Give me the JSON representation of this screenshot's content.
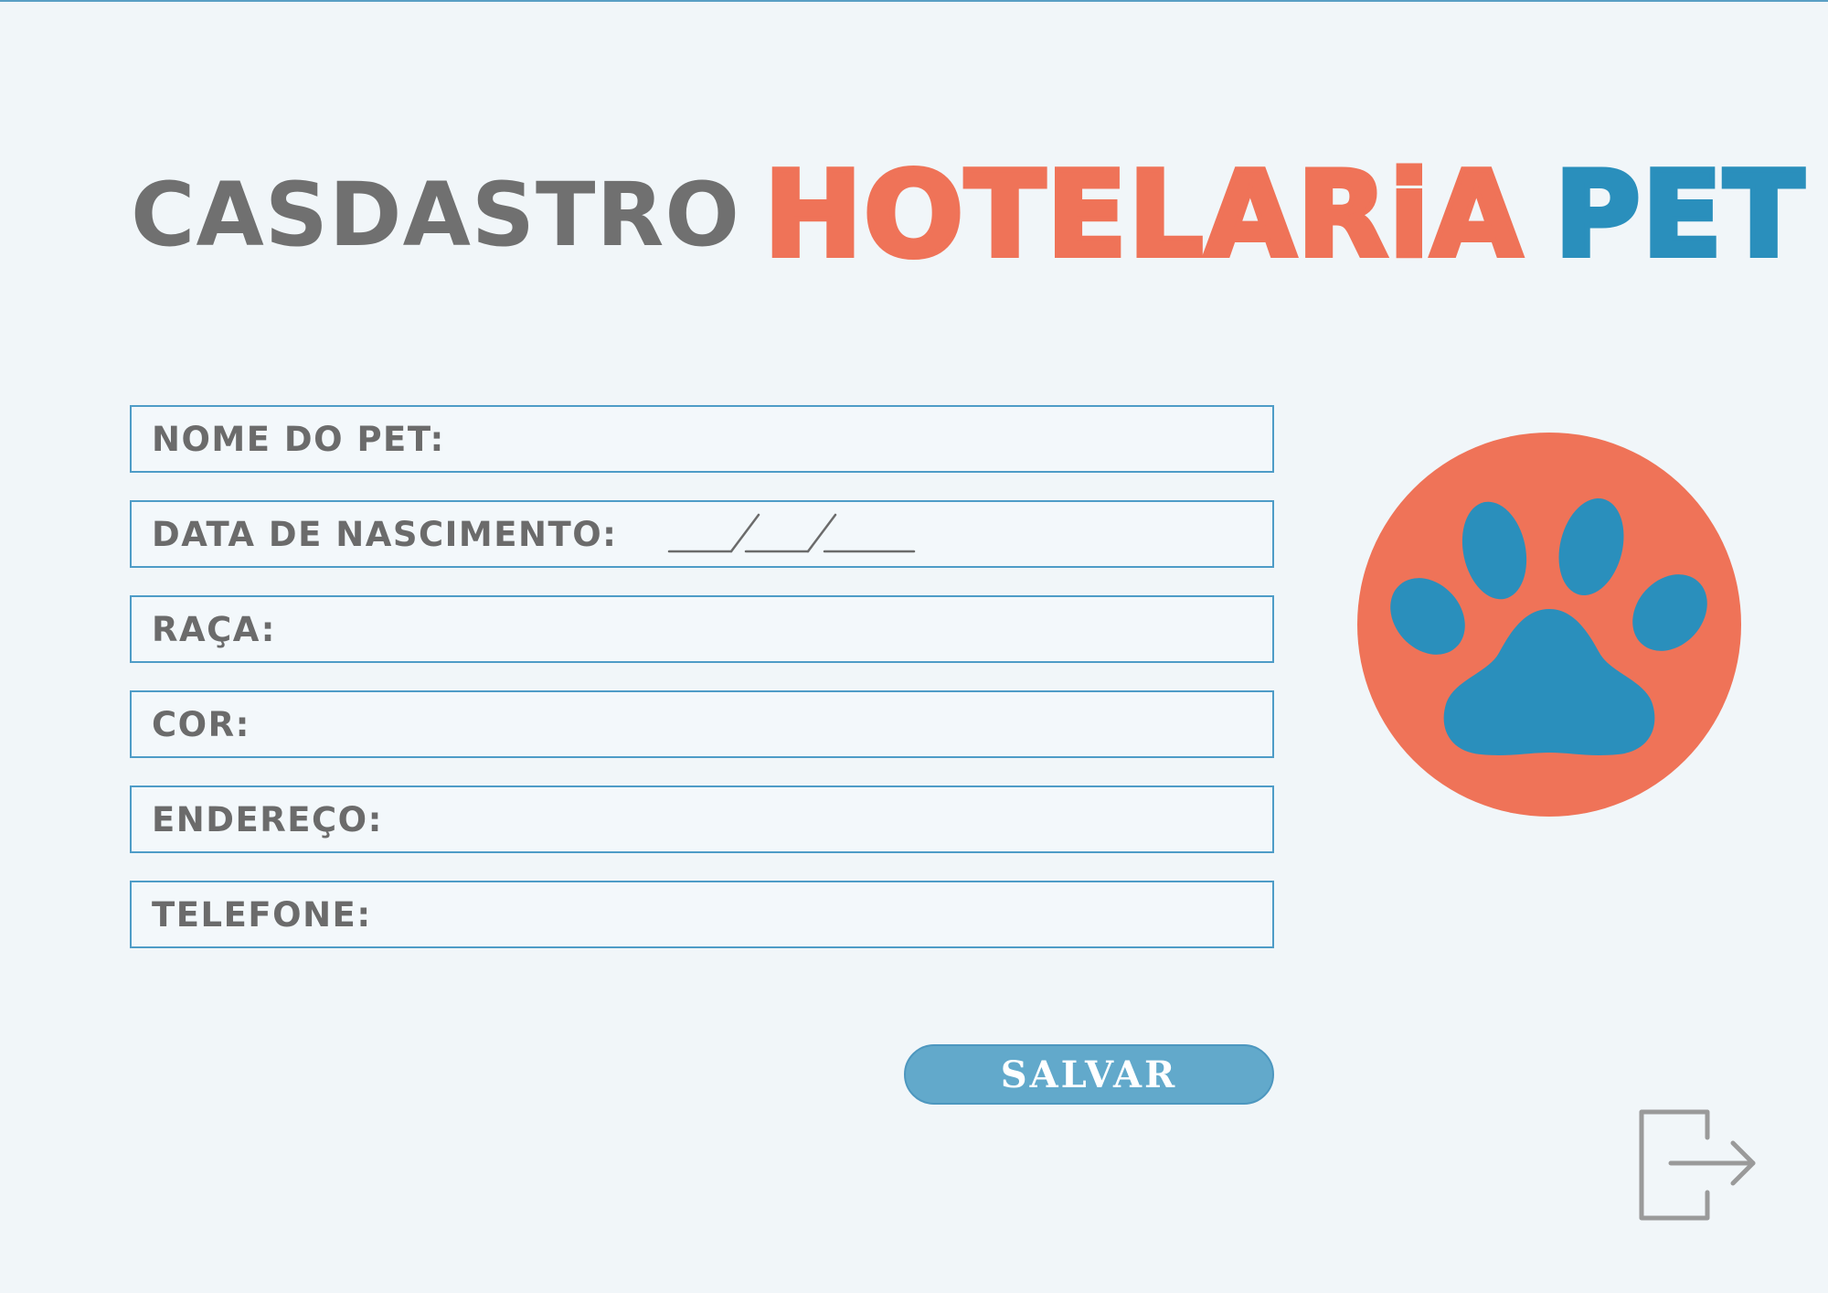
{
  "header": {
    "title_prefix": "CASDASTRO",
    "title_brand_part1": "HOTELARiA",
    "title_brand_part2": "PET",
    "brand_colors": {
      "orange": "#ef7358",
      "blue": "#2a8fbc",
      "gray": "#707070"
    }
  },
  "form": {
    "fields": [
      {
        "label": "NOME DO PET:",
        "value": ""
      },
      {
        "label": "DATA DE NASCIMENTO:",
        "value": ""
      },
      {
        "label": "RAÇA:",
        "value": ""
      },
      {
        "label": "COR:",
        "value": ""
      },
      {
        "label": "ENDEREÇO:",
        "value": ""
      },
      {
        "label": "TELEFONE:",
        "value": ""
      }
    ],
    "field_border_color": "#4e9cc7"
  },
  "actions": {
    "save_label": "SALVAR",
    "save_color": "#62a9cb",
    "exit_icon": "logout-icon"
  },
  "logo": {
    "icon": "paw-icon",
    "circle_color": "#ef7358",
    "paw_color": "#2a8fbc"
  }
}
